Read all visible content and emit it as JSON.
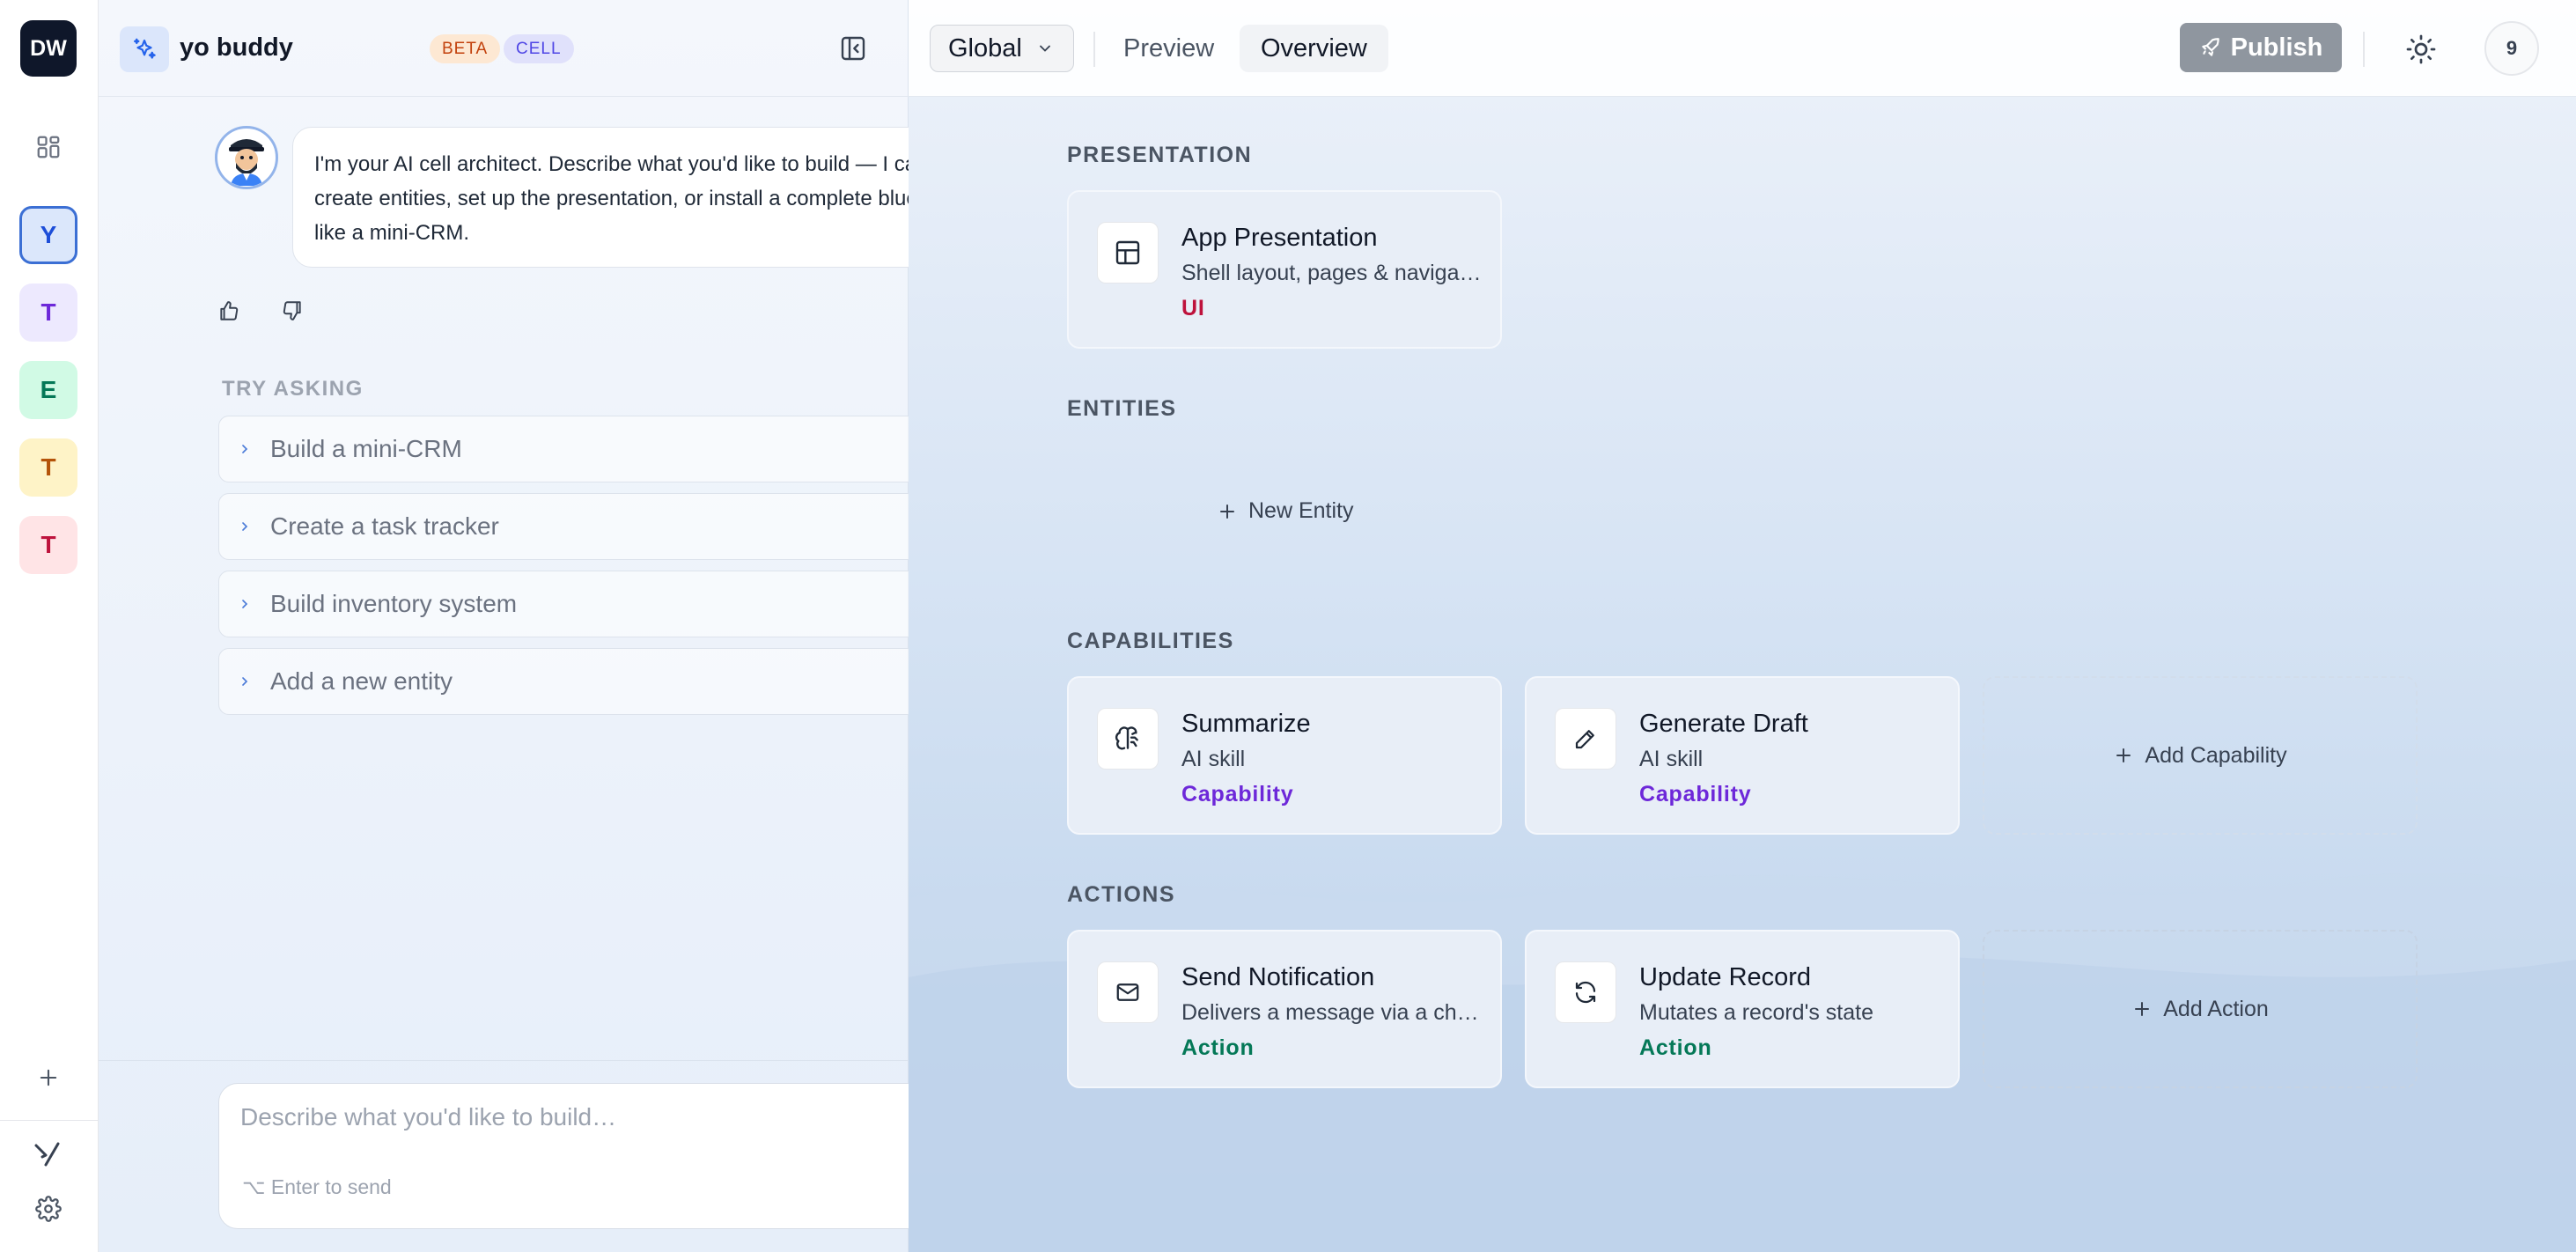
{
  "rail": {
    "logo": "DW",
    "workspaces": [
      {
        "letter": "Y",
        "bg": "#dbe7fb",
        "fg": "#1d4ed8",
        "active": true
      },
      {
        "letter": "T",
        "bg": "#ede9fe",
        "fg": "#6d28d9"
      },
      {
        "letter": "E",
        "bg": "#d1fae5",
        "fg": "#047857"
      },
      {
        "letter": "T",
        "bg": "#fef3c7",
        "fg": "#b45309"
      },
      {
        "letter": "T",
        "bg": "#ffe4e6",
        "fg": "#be123c"
      }
    ],
    "icons": [
      "grid-icon",
      "plus-icon",
      "brand-logo-icon",
      "gear-icon"
    ]
  },
  "chat": {
    "title": "yo buddy",
    "badges": [
      "BETA",
      "CELL"
    ],
    "message": "I'm your AI cell architect. Describe what you'd like to build — I can create entities, set up the presentation, or install a complete blueprint like a mini-CRM.",
    "try_asking_label": "TRY ASKING",
    "suggestions": [
      "Build a mini-CRM",
      "Create a task tracker",
      "Build inventory system",
      "Add a new entity"
    ],
    "composer": {
      "placeholder": "Describe what you'd like to build…",
      "hint": "⌥ Enter to send"
    }
  },
  "topbar": {
    "scope": "Global",
    "tabs": [
      "Preview",
      "Overview"
    ],
    "active_tab": "Overview",
    "publish_label": "Publish",
    "notification_count": "9"
  },
  "overview": {
    "presentation": {
      "title": "PRESENTATION",
      "card": {
        "name": "App Presentation",
        "subtitle": "Shell layout, pages & navigation",
        "badge": "UI",
        "badge_color": "#be123c",
        "icon": "layout-icon"
      }
    },
    "entities": {
      "title": "ENTITIES",
      "new_label": "New Entity"
    },
    "capabilities": {
      "title": "CAPABILITIES",
      "cards": [
        {
          "name": "Summarize",
          "subtitle": "AI skill",
          "badge": "Capability",
          "badge_color": "#6d28d9",
          "icon": "brain-icon"
        },
        {
          "name": "Generate Draft",
          "subtitle": "AI skill",
          "badge": "Capability",
          "badge_color": "#6d28d9",
          "icon": "pencil-icon"
        }
      ],
      "add_label": "Add Capability"
    },
    "actions": {
      "title": "ACTIONS",
      "cards": [
        {
          "name": "Send Notification",
          "subtitle": "Delivers a message via a channel",
          "badge": "Action",
          "badge_color": "#047857",
          "icon": "mail-icon"
        },
        {
          "name": "Update Record",
          "subtitle": "Mutates a record's state",
          "badge": "Action",
          "badge_color": "#047857",
          "icon": "refresh-icon"
        }
      ],
      "add_label": "Add Action"
    }
  }
}
